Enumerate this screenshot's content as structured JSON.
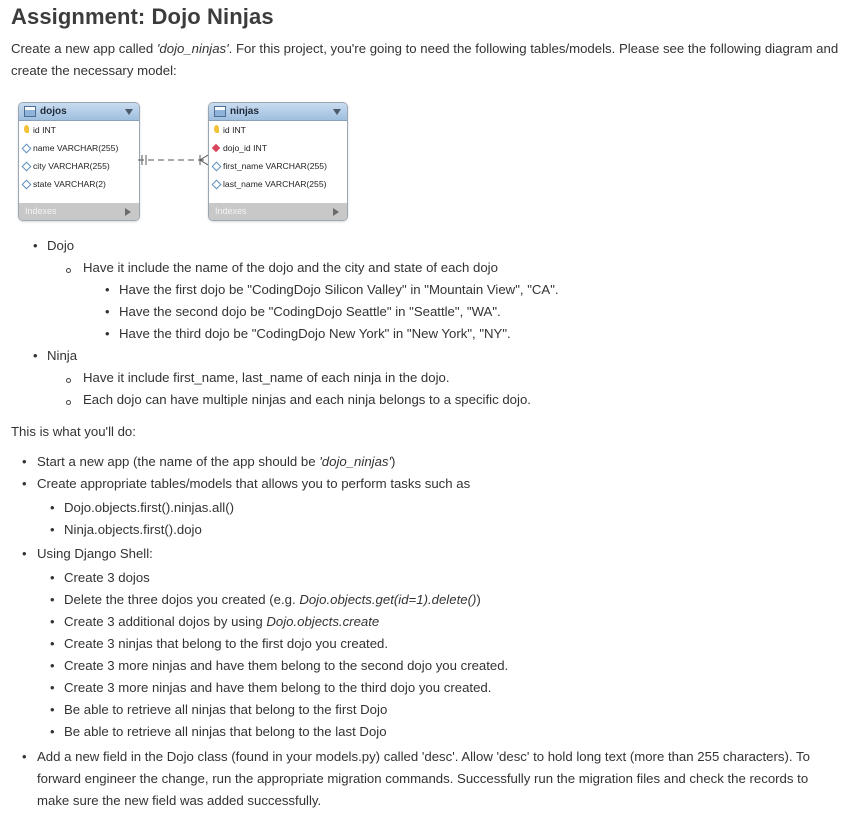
{
  "title": "Assignment: Dojo Ninjas",
  "intro": {
    "before": "Create a new app called ",
    "app_name": "'dojo_ninjas'",
    "after": ". For this project, you're going to need the following tables/models. Please see the following diagram and create the necessary model:"
  },
  "diagram": {
    "dojos": {
      "name": "dojos",
      "columns": [
        {
          "marker": "key",
          "text": "id INT"
        },
        {
          "marker": "nullable",
          "text": "name VARCHAR(255)"
        },
        {
          "marker": "nullable",
          "text": "city VARCHAR(255)"
        },
        {
          "marker": "nullable",
          "text": "state VARCHAR(2)"
        }
      ],
      "footer": "Indexes"
    },
    "ninjas": {
      "name": "ninjas",
      "columns": [
        {
          "marker": "key",
          "text": "id INT"
        },
        {
          "marker": "foreign-key",
          "text": "dojo_id INT"
        },
        {
          "marker": "nullable",
          "text": "first_name VARCHAR(255)"
        },
        {
          "marker": "nullable",
          "text": "last_name VARCHAR(255)"
        }
      ],
      "footer": "Indexes"
    },
    "relationship": "one-to-many"
  },
  "spec": {
    "dojo": {
      "label": "Dojo",
      "sub": "Have it include the name of the dojo and the city and state of each dojo",
      "items": [
        "Have the first dojo be \"CodingDojo Silicon Valley\" in \"Mountain View\", \"CA\".",
        "Have the second dojo be \"CodingDojo Seattle\" in \"Seattle\", \"WA\".",
        "Have the third dojo be \"CodingDojo New York\" in \"New York\", \"NY\"."
      ]
    },
    "ninja": {
      "label": "Ninja",
      "items": [
        "Have it include first_name, last_name of each ninja in the dojo.",
        "Each dojo can have multiple ninjas and each ninja belongs to a specific dojo."
      ]
    }
  },
  "todo_heading": "This is what you'll do:",
  "tasks": {
    "start_app": {
      "before": "Start a new app (the name of the app should be ",
      "name": "'dojo_ninjas'",
      "after": ")"
    },
    "create_models": {
      "label": "Create appropriate tables/models that allows you to perform tasks such as",
      "examples": [
        "Dojo.objects.first().ninjas.all()",
        "Ninja.objects.first().dojo"
      ]
    },
    "shell": {
      "label": "Using Django Shell:",
      "steps": [
        {
          "text": "Create 3 dojos"
        },
        {
          "text": "Delete the three dojos you created (e.g. ",
          "code": "Dojo.objects.get(id=1).delete()",
          "after": ")"
        },
        {
          "text": "Create 3 additional dojos by using ",
          "code": "Dojo.objects.create",
          "after": ""
        },
        {
          "text": "Create 3 ninjas that belong to the first dojo you created."
        },
        {
          "text": "Create 3 more ninjas and have them belong to the second dojo you created."
        },
        {
          "text": "Create 3 more ninjas and have them belong to the third dojo you created."
        },
        {
          "text": "Be able to retrieve all ninjas that belong to the first Dojo"
        },
        {
          "text": "Be able to retrieve all ninjas that belong to the last Dojo"
        }
      ]
    },
    "desc_field": "Add a new field in the Dojo class (found in your models.py) called 'desc'. Allow 'desc' to hold long text (more than 255 characters). To forward engineer the change, run the appropriate migration commands. Successfully run the migration files and check the records to make sure the new field was added successfully."
  }
}
